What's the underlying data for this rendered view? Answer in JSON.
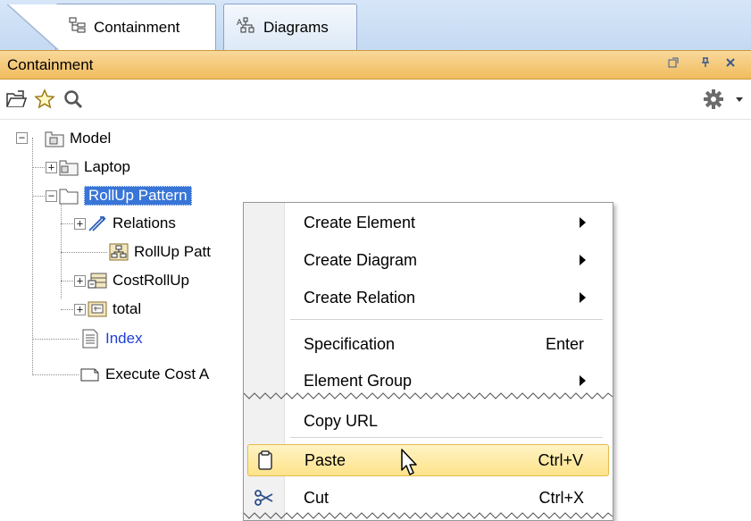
{
  "tabs": [
    {
      "label": "Containment",
      "icon": "containment-tree-icon",
      "active": true
    },
    {
      "label": "Diagrams",
      "icon": "diagrams-icon",
      "active": false
    }
  ],
  "panel": {
    "title": "Containment",
    "controls": [
      "undock-icon",
      "pin-icon",
      "close-icon"
    ]
  },
  "toolbar": {
    "left_icons": [
      "open-icon",
      "favorite-star-icon",
      "search-icon"
    ],
    "right_icons": [
      "gear-icon",
      "dropdown-arrow-icon"
    ]
  },
  "tree": {
    "nodes": [
      {
        "label": "Model",
        "icon": "model-package-icon"
      },
      {
        "label": "Laptop",
        "icon": "package-icon"
      },
      {
        "label": "RollUp Pattern",
        "icon": "folder-icon",
        "selected": true
      },
      {
        "label": "Relations",
        "icon": "relation-icon"
      },
      {
        "label": "RollUp Patt",
        "icon": "diagram-icon"
      },
      {
        "label": "CostRollUp",
        "icon": "block-icon"
      },
      {
        "label": "total",
        "icon": "value-property-icon"
      },
      {
        "label": "Index",
        "icon": "document-icon"
      },
      {
        "label": "Execute Cost A",
        "icon": "action-icon"
      }
    ]
  },
  "context_menu": {
    "items": [
      {
        "label": "Create Element",
        "shortcut": "",
        "submenu": true
      },
      {
        "label": "Create Diagram",
        "shortcut": "",
        "submenu": true
      },
      {
        "label": "Create Relation",
        "shortcut": "",
        "submenu": true
      },
      {
        "label": "Specification",
        "shortcut": "Enter",
        "submenu": false
      },
      {
        "label": "Element Group",
        "shortcut": "",
        "submenu": true
      },
      {
        "label": "Copy URL",
        "shortcut": "",
        "submenu": false
      },
      {
        "label": "Paste",
        "shortcut": "Ctrl+V",
        "submenu": false,
        "icon": "clipboard-icon",
        "highlighted": true
      },
      {
        "label": "Cut",
        "shortcut": "Ctrl+X",
        "submenu": false,
        "icon": "scissors-icon"
      }
    ]
  },
  "colors": {
    "selection": "#3875d7",
    "panel_header": "#f0bc5e",
    "menu_highlight": "#fde38a",
    "link_text": "#1f3fd6"
  }
}
